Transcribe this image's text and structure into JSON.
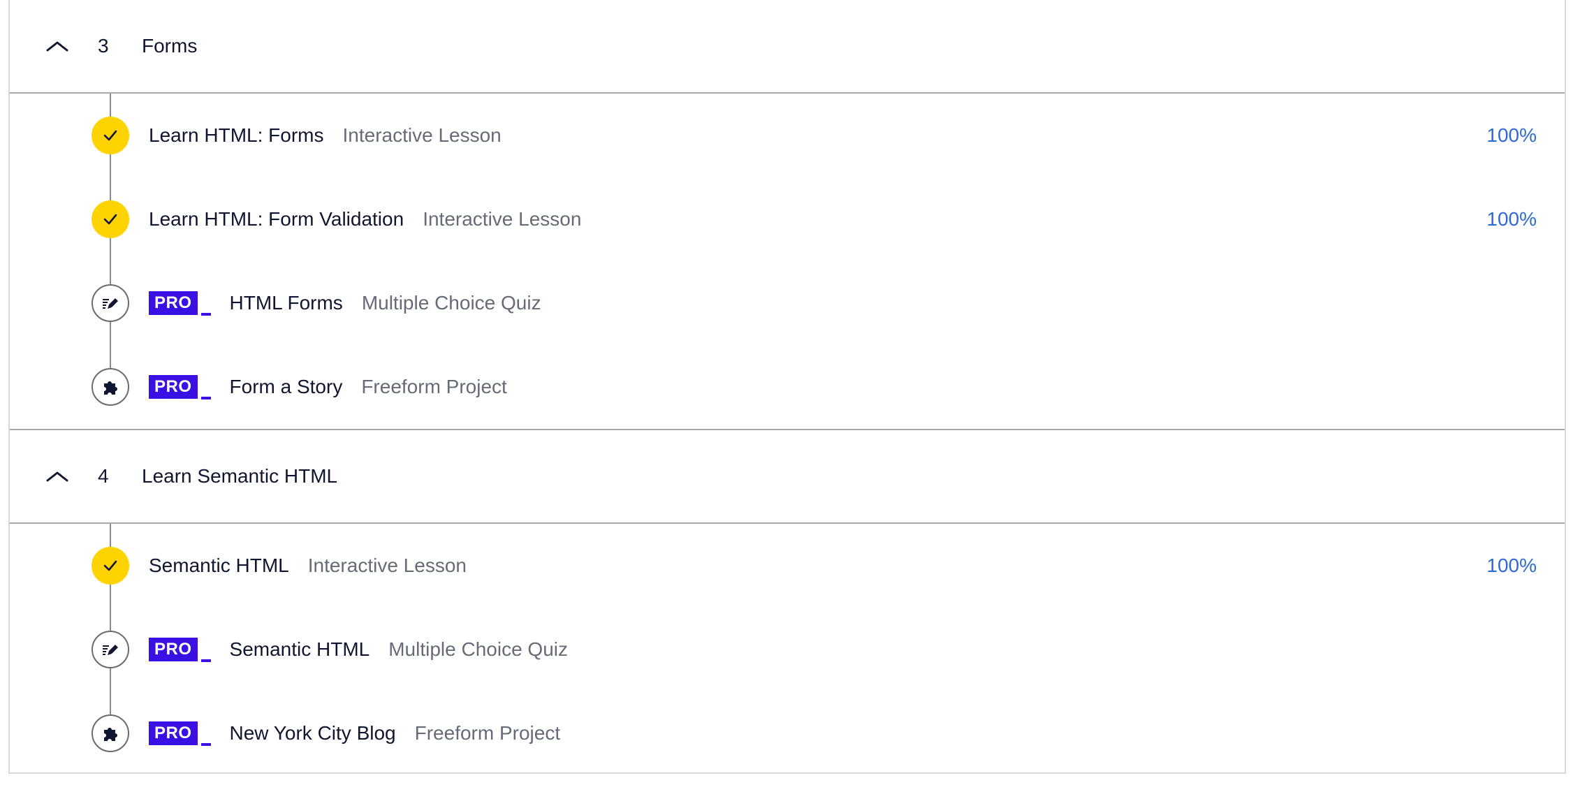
{
  "modules": [
    {
      "number": "3",
      "title": "Forms",
      "items": [
        {
          "name": "Learn HTML: Forms",
          "type": "Interactive Lesson",
          "status": "complete",
          "icon": "check-icon",
          "pro": false,
          "progress": "100%"
        },
        {
          "name": "Learn HTML: Form Validation",
          "type": "Interactive Lesson",
          "status": "complete",
          "icon": "check-icon",
          "pro": false,
          "progress": "100%"
        },
        {
          "name": "HTML Forms",
          "type": "Multiple Choice Quiz",
          "status": "incomplete",
          "icon": "quiz-pencil-icon",
          "pro": true,
          "pro_label": "PRO",
          "progress": ""
        },
        {
          "name": "Form a Story",
          "type": "Freeform Project",
          "status": "incomplete",
          "icon": "puzzle-icon",
          "pro": true,
          "pro_label": "PRO",
          "progress": ""
        }
      ]
    },
    {
      "number": "4",
      "title": "Learn Semantic HTML",
      "items": [
        {
          "name": "Semantic HTML",
          "type": "Interactive Lesson",
          "status": "complete",
          "icon": "check-icon",
          "pro": false,
          "progress": "100%"
        },
        {
          "name": "Semantic HTML",
          "type": "Multiple Choice Quiz",
          "status": "incomplete",
          "icon": "quiz-pencil-icon",
          "pro": true,
          "pro_label": "PRO",
          "progress": ""
        },
        {
          "name": "New York City Blog",
          "type": "Freeform Project",
          "status": "incomplete",
          "icon": "puzzle-icon",
          "pro": true,
          "pro_label": "PRO",
          "progress": ""
        }
      ]
    }
  ],
  "colors": {
    "complete_marker": "#ffd300",
    "pro_badge": "#3a10e5",
    "progress_text": "#2d6ad9",
    "type_text": "#666b78"
  }
}
